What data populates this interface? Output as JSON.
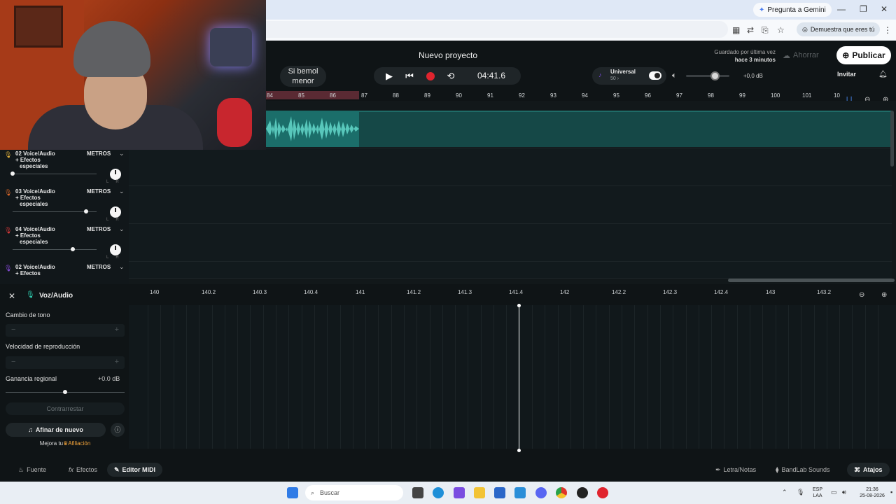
{
  "browser": {
    "gemini_button": "Pregunta a Gemini",
    "verify_pill": "Demuestra que eres tú"
  },
  "header": {
    "project_title": "Nuevo proyecto",
    "saved_line1": "Guardado por última vez",
    "saved_line2": "hace 3 minutos",
    "save_button": "Ahorrar",
    "publish_button": "Publicar",
    "key_line1": "Si bemol",
    "key_line2": "menor",
    "time": "04:41.6",
    "universal_label": "Universal",
    "universal_value": "50",
    "volume_db": "+0,0 dB",
    "invite_button": "Invitar"
  },
  "ruler_ticks": [
    "84",
    "85",
    "86",
    "87",
    "88",
    "89",
    "90",
    "91",
    "92",
    "93",
    "94",
    "95",
    "96",
    "97",
    "98",
    "99",
    "100",
    "101",
    "10"
  ],
  "tracks": [
    {
      "name": "02  Voice/Audio",
      "fx1": "+ Efectos",
      "fx2": "especiales",
      "meters": "METROS"
    },
    {
      "name": "03  Voice/Audio",
      "fx1": "+ Efectos",
      "fx2": "especiales",
      "meters": "METROS"
    },
    {
      "name": "04  Voice/Audio",
      "fx1": "+ Efectos",
      "fx2": "especiales",
      "meters": "METROS"
    },
    {
      "name": "02  Voice/Audio",
      "fx1": "+ Efectos",
      "fx2": "",
      "meters": "METROS"
    }
  ],
  "editor": {
    "track_label": "Voz/Audio",
    "pitch_label": "Cambio de tono",
    "speed_label": "Velocidad de reproducción",
    "gain_label": "Ganancia regional",
    "gain_value": "+0.0 dB",
    "reset_button": "Contrarrestar",
    "retune_button": "Afinar de nuevo",
    "upgrade_text": "Mejora tu",
    "upgrade_link": "Afiliación",
    "ticks": [
      "140",
      "140.2",
      "140.3",
      "140.4",
      "141",
      "141.2",
      "141.3",
      "141.4",
      "142",
      "142.2",
      "142.3",
      "142.4",
      "143",
      "143.2"
    ]
  },
  "bottom_bar": {
    "source": "Fuente",
    "effects": "Efectos",
    "midi_editor": "Editor MIDI",
    "lyrics": "Letra/Notas",
    "sounds": "BandLab Sounds",
    "shortcuts": "Atajos"
  },
  "taskbar": {
    "search": "Buscar",
    "lang1": "ESP",
    "lang2": "LAA",
    "time": "21:36",
    "date": "25-08-2026"
  },
  "colors": {
    "accent_teal": "#1b6e6a",
    "record_red": "#e0242e",
    "selection_red": "#5a2a33",
    "affiliation_orange": "#f0a23a"
  }
}
